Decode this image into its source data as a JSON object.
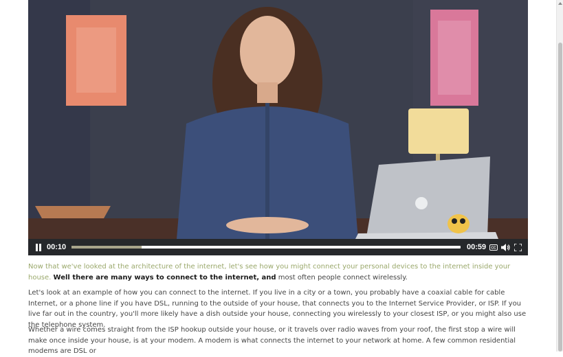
{
  "player": {
    "current_time": "00:10",
    "duration": "00:59",
    "progress": 0.18,
    "icons": [
      "pause-icon",
      "captions-icon",
      "volume-icon",
      "fullscreen-icon"
    ],
    "captions_label": "CC"
  },
  "article": {
    "p1_green": "Now that we've looked at the architecture of the internet, let's see how you might connect your personal devices to the internet inside your house.",
    "p1_bold": "Well there are many ways to connect to the internet, and",
    "p1_rest": "most often people connect wirelessly.",
    "p2": "Let's look at an example of how you can connect to the internet. If you live in a city or a town, you probably have a coaxial cable for cable Internet, or a phone line if you have DSL, running to the outside of your house, that connects you to the Internet Service Provider, or ISP. If you live far out in the country, you'll more likely have a dish outside your house, connecting you wirelessly to your closest ISP, or you might also use the telephone system.",
    "p3": "Whether a wire comes straight from the ISP hookup outside your house, or it travels over radio waves from your roof, the first stop a wire will make once inside your house, is at your modem. A modem is what connects the internet to your network at home. A few common residential modems are DSL or"
  },
  "colors": {
    "highlight_green": "#9aa86b",
    "player_bar": "#26282b",
    "progress_played": "#a8a58b"
  }
}
